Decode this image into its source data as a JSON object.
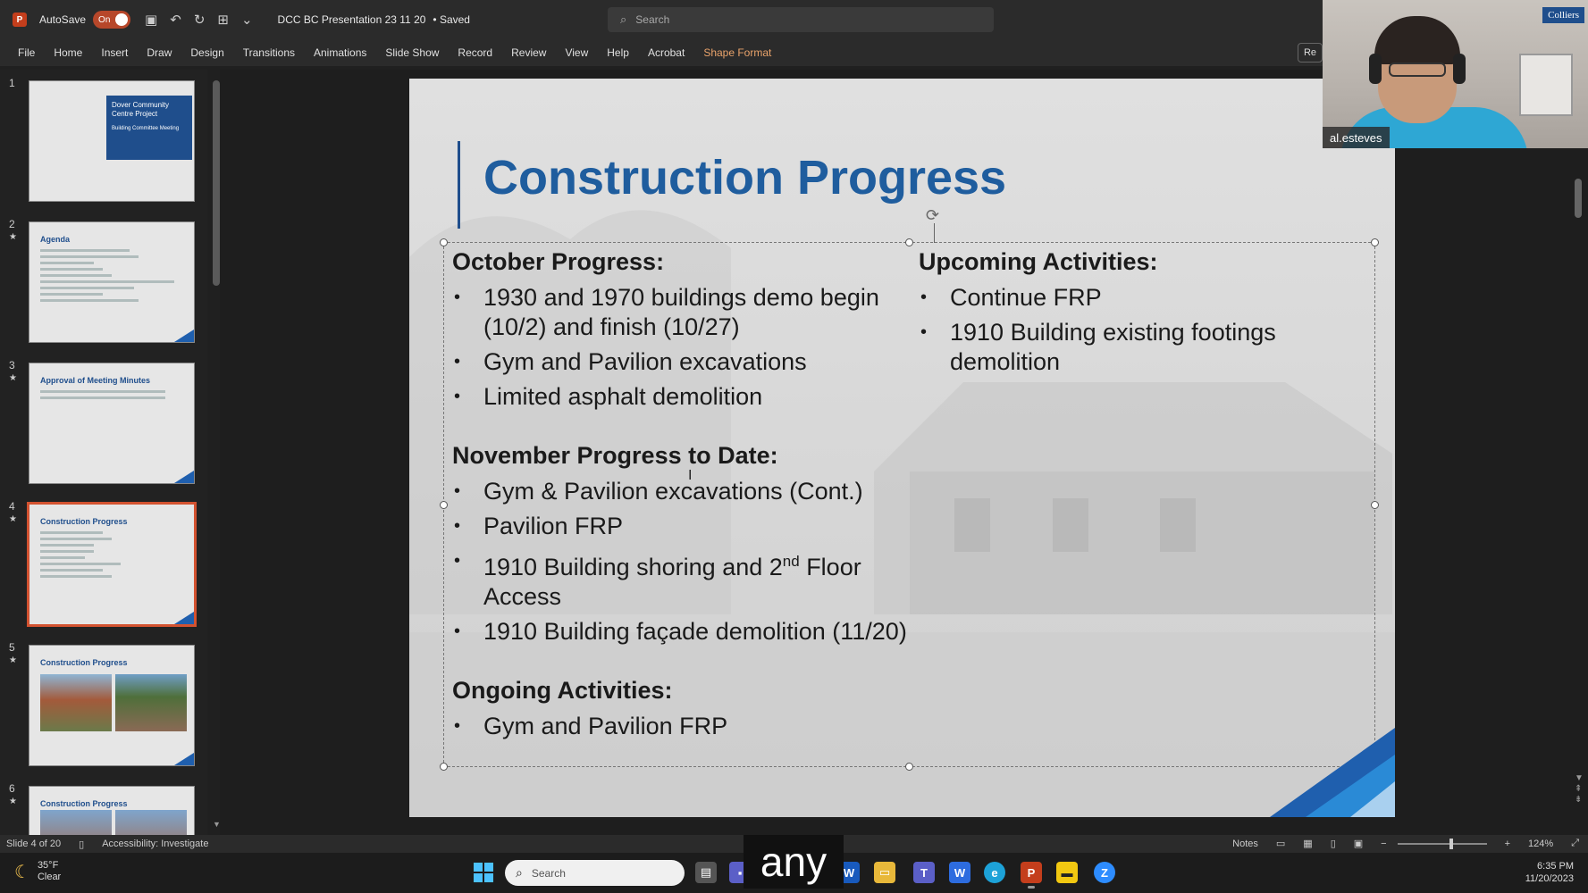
{
  "titlebar": {
    "autosave_label": "AutoSave",
    "autosave_state": "On",
    "doc_title": "DCC  BC Presentation 23 11 20",
    "saved_state": "• Saved",
    "search_placeholder": "Search"
  },
  "menu": [
    "File",
    "Home",
    "Insert",
    "Draw",
    "Design",
    "Transitions",
    "Animations",
    "Slide Show",
    "Record",
    "Review",
    "View",
    "Help",
    "Acrobat",
    "Shape Format"
  ],
  "record_button": "Re",
  "thumbnails": [
    {
      "num": "1",
      "title": "Dover Community Centre Project",
      "subtitle": "Building Committee Meeting"
    },
    {
      "num": "2",
      "title": "Agenda"
    },
    {
      "num": "3",
      "title": "Approval of Meeting Minutes"
    },
    {
      "num": "4",
      "title": "Construction Progress"
    },
    {
      "num": "5",
      "title": "Construction Progress"
    },
    {
      "num": "6",
      "title": "Construction Progress"
    }
  ],
  "slide": {
    "title": "Construction Progress",
    "october_heading": "October Progress:",
    "october_items": [
      "1930 and 1970 buildings demo begin (10/2) and finish (10/27)",
      "Gym and Pavilion excavations",
      "Limited asphalt demolition"
    ],
    "november_heading": "November Progress to Date:",
    "november_items": {
      "a": "Gym & Pavilion excavations (Cont.)",
      "b": "Pavilion FRP",
      "c_pre": "1910 Building shoring and 2",
      "c_sup": "nd",
      "c_post": " Floor Access",
      "d": "1910 Building façade demolition (11/20)"
    },
    "ongoing_heading": "Ongoing Activities:",
    "ongoing_items": [
      "Gym and Pavilion FRP"
    ],
    "upcoming_heading": "Upcoming Activities:",
    "upcoming_items": [
      "Continue FRP",
      "1910 Building existing footings demolition"
    ]
  },
  "webcam": {
    "name": "al.esteves",
    "brand": "Colliers"
  },
  "statusbar": {
    "slide_info": "Slide 4 of 20",
    "accessibility": "Accessibility: Investigate",
    "notes": "Notes",
    "zoom": "124%"
  },
  "taskbar": {
    "temp": "35°F",
    "condition": "Clear",
    "search_placeholder": "Search",
    "time": "6:35 PM",
    "date": "11/20/2023"
  },
  "caption": "any",
  "colors": {
    "accent": "#d35230",
    "slide_title": "#1f5d9e",
    "brand_blue": "#1f4e8c"
  }
}
